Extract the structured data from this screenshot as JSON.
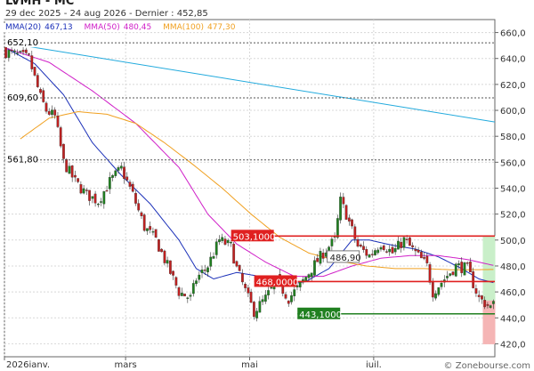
{
  "header": {
    "title": "LVMH - MC",
    "subtitle": "29 dec 2025 - 24 aug 2026 - Dernier : 452,85"
  },
  "legend": [
    {
      "label": "MMA(20)",
      "value": "467,13",
      "color": "#1a2fb8"
    },
    {
      "label": "MMA(50)",
      "value": "480,45",
      "color": "#d020c8"
    },
    {
      "label": "MMA(100)",
      "value": "477,30",
      "color": "#f0a020"
    }
  ],
  "watermark": "© Zonebourse.com",
  "chart_data": {
    "type": "candlestick",
    "ylim": [
      410,
      670
    ],
    "y_ticks": [
      "660,0",
      "640,0",
      "620,0",
      "600,0",
      "580,0",
      "560,0",
      "540,0",
      "520,0",
      "500,0",
      "480,0",
      "460,0",
      "440,0",
      "420,0"
    ],
    "y_tick_values": [
      660,
      640,
      620,
      600,
      580,
      560,
      540,
      520,
      500,
      480,
      460,
      440,
      420
    ],
    "x_labels": [
      "2026janv.",
      "mars",
      "mai",
      "juil."
    ],
    "x_label_positions": [
      0,
      42,
      85,
      128
    ],
    "n_bars": 170,
    "last_close": 452.85,
    "close_anchors": [
      [
        0,
        645
      ],
      [
        8,
        640
      ],
      [
        12,
        610
      ],
      [
        14,
        600
      ],
      [
        17,
        595
      ],
      [
        20,
        560
      ],
      [
        24,
        545
      ],
      [
        28,
        535
      ],
      [
        32,
        530
      ],
      [
        36,
        545
      ],
      [
        40,
        555
      ],
      [
        44,
        535
      ],
      [
        48,
        510
      ],
      [
        52,
        500
      ],
      [
        56,
        480
      ],
      [
        60,
        460
      ],
      [
        64,
        455
      ],
      [
        66,
        470
      ],
      [
        70,
        480
      ],
      [
        74,
        500
      ],
      [
        78,
        495
      ],
      [
        80,
        478
      ],
      [
        84,
        455
      ],
      [
        86,
        445
      ],
      [
        90,
        455
      ],
      [
        94,
        468
      ],
      [
        98,
        455
      ],
      [
        102,
        465
      ],
      [
        106,
        478
      ],
      [
        110,
        490
      ],
      [
        114,
        500
      ],
      [
        116,
        530
      ],
      [
        118,
        520
      ],
      [
        122,
        495
      ],
      [
        126,
        488
      ],
      [
        130,
        498
      ],
      [
        134,
        490
      ],
      [
        138,
        500
      ],
      [
        142,
        490
      ],
      [
        146,
        480
      ],
      [
        148,
        460
      ],
      [
        152,
        470
      ],
      [
        156,
        480
      ],
      [
        160,
        478
      ],
      [
        164,
        455
      ],
      [
        168,
        448
      ],
      [
        169,
        452.85
      ]
    ],
    "series": [
      {
        "name": "MMA(20)",
        "color": "#1a2fb8",
        "anchors": [
          [
            0,
            648
          ],
          [
            10,
            636
          ],
          [
            20,
            612
          ],
          [
            30,
            575
          ],
          [
            40,
            550
          ],
          [
            50,
            528
          ],
          [
            60,
            500
          ],
          [
            66,
            478
          ],
          [
            72,
            470
          ],
          [
            80,
            475
          ],
          [
            88,
            472
          ],
          [
            96,
            465
          ],
          [
            104,
            468
          ],
          [
            112,
            478
          ],
          [
            120,
            500
          ],
          [
            126,
            500
          ],
          [
            134,
            496
          ],
          [
            142,
            493
          ],
          [
            150,
            487
          ],
          [
            158,
            478
          ],
          [
            164,
            470
          ],
          [
            169,
            467.13
          ]
        ]
      },
      {
        "name": "MMA(50)",
        "color": "#d020c8",
        "anchors": [
          [
            0,
            648
          ],
          [
            15,
            637
          ],
          [
            30,
            615
          ],
          [
            45,
            590
          ],
          [
            60,
            556
          ],
          [
            70,
            520
          ],
          [
            80,
            497
          ],
          [
            90,
            483
          ],
          [
            100,
            472
          ],
          [
            110,
            472
          ],
          [
            120,
            480
          ],
          [
            130,
            486
          ],
          [
            140,
            488
          ],
          [
            150,
            488
          ],
          [
            160,
            485
          ],
          [
            169,
            480.45
          ]
        ]
      },
      {
        "name": "MMA(100)",
        "color": "#f0a020",
        "anchors": [
          [
            5,
            578
          ],
          [
            15,
            594
          ],
          [
            25,
            599
          ],
          [
            35,
            597
          ],
          [
            45,
            590
          ],
          [
            55,
            575
          ],
          [
            65,
            558
          ],
          [
            75,
            540
          ],
          [
            85,
            520
          ],
          [
            95,
            502
          ],
          [
            105,
            490
          ],
          [
            115,
            484
          ],
          [
            125,
            480
          ],
          [
            135,
            478
          ],
          [
            145,
            478
          ],
          [
            155,
            477
          ],
          [
            169,
            477.3
          ]
        ]
      }
    ],
    "trendline": {
      "color": "#22aadd",
      "from": [
        0,
        652.1
      ],
      "to": [
        170,
        591
      ]
    },
    "levels": [
      {
        "value": 652.1,
        "label": "652,10",
        "style": "dashed",
        "color": "#555555",
        "label_bg": "#ffffff",
        "label_color": "#000000"
      },
      {
        "value": 609.6,
        "label": "609,60",
        "style": "dashed",
        "color": "#555555",
        "label_bg": "#ffffff",
        "label_color": "#000000"
      },
      {
        "value": 561.8,
        "label": "561,80",
        "style": "dashed",
        "color": "#555555",
        "label_bg": "#ffffff",
        "label_color": "#000000"
      },
      {
        "value": 503.1,
        "label": "503,1000",
        "style": "solid",
        "color": "#e02020",
        "label_bg": "#e02020",
        "label_color": "#ffffff",
        "label_at": 79
      },
      {
        "value": 468.0,
        "label": "468,0000",
        "style": "solid",
        "color": "#e02020",
        "label_bg": "#e02020",
        "label_color": "#ffffff",
        "label_at": 87
      },
      {
        "value": 443.1,
        "label": "443,1000",
        "style": "solid",
        "color": "#208020",
        "label_bg": "#208020",
        "label_color": "#ffffff",
        "label_at": 102
      }
    ],
    "annotation": {
      "label": "486,90",
      "value": 486.9,
      "at": 112
    },
    "zones": [
      {
        "from": 503,
        "to": 443,
        "color": "#c9efc9"
      },
      {
        "from": 453,
        "to": 420,
        "color": "#f5b5b5"
      }
    ]
  }
}
